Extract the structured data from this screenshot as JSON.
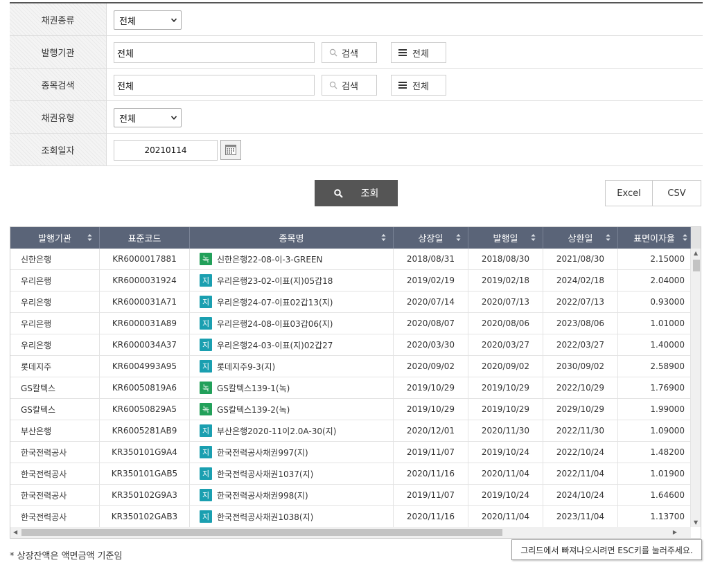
{
  "filters": {
    "bond_type": {
      "label": "채권종류",
      "value": "전체"
    },
    "issuer": {
      "label": "발행기관",
      "value": "전체",
      "search_label": "검색",
      "all_label": "전체"
    },
    "item_search": {
      "label": "종목검색",
      "value": "전체",
      "search_label": "검색",
      "all_label": "전체"
    },
    "bond_kind": {
      "label": "채권유형",
      "value": "전체"
    },
    "query_date": {
      "label": "조회일자",
      "value": "20210114"
    }
  },
  "actions": {
    "query_label": "조회",
    "excel_label": "Excel",
    "csv_label": "CSV"
  },
  "grid": {
    "columns": [
      "발행기관",
      "표준코드",
      "종목명",
      "상장일",
      "발행일",
      "상환일",
      "표면이자율"
    ],
    "rows": [
      {
        "issuer": "신한은행",
        "code": "KR6000017881",
        "badge": "녹",
        "name": "신한은행22-08-이-3-GREEN",
        "listed": "2018/08/31",
        "issued": "2018/08/30",
        "maturity": "2021/08/30",
        "rate": "2.15000"
      },
      {
        "issuer": "우리은행",
        "code": "KR6000031924",
        "badge": "지",
        "name": "우리은행23-02-이표(지)05갑18",
        "listed": "2019/02/19",
        "issued": "2019/02/18",
        "maturity": "2024/02/18",
        "rate": "2.04000"
      },
      {
        "issuer": "우리은행",
        "code": "KR6000031A71",
        "badge": "지",
        "name": "우리은행24-07-이표02갑13(지)",
        "listed": "2020/07/14",
        "issued": "2020/07/13",
        "maturity": "2022/07/13",
        "rate": "0.93000"
      },
      {
        "issuer": "우리은행",
        "code": "KR6000031A89",
        "badge": "지",
        "name": "우리은행24-08-이표03갑06(지)",
        "listed": "2020/08/07",
        "issued": "2020/08/06",
        "maturity": "2023/08/06",
        "rate": "1.01000"
      },
      {
        "issuer": "우리은행",
        "code": "KR6000034A37",
        "badge": "지",
        "name": "우리은행24-03-이표(지)02갑27",
        "listed": "2020/03/30",
        "issued": "2020/03/27",
        "maturity": "2022/03/27",
        "rate": "1.40000"
      },
      {
        "issuer": "롯데지주",
        "code": "KR6004993A95",
        "badge": "지",
        "name": "롯데지주9-3(지)",
        "listed": "2020/09/02",
        "issued": "2020/09/02",
        "maturity": "2030/09/02",
        "rate": "2.58900"
      },
      {
        "issuer": "GS칼텍스",
        "code": "KR60050819A6",
        "badge": "녹",
        "name": "GS칼텍스139-1(녹)",
        "listed": "2019/10/29",
        "issued": "2019/10/29",
        "maturity": "2022/10/29",
        "rate": "1.76900"
      },
      {
        "issuer": "GS칼텍스",
        "code": "KR60050829A5",
        "badge": "녹",
        "name": "GS칼텍스139-2(녹)",
        "listed": "2019/10/29",
        "issued": "2019/10/29",
        "maturity": "2029/10/29",
        "rate": "1.99000"
      },
      {
        "issuer": "부산은행",
        "code": "KR6005281AB9",
        "badge": "지",
        "name": "부산은행2020-11이2.0A-30(지)",
        "listed": "2020/12/01",
        "issued": "2020/11/30",
        "maturity": "2022/11/30",
        "rate": "1.09000"
      },
      {
        "issuer": "한국전력공사",
        "code": "KR350101G9A4",
        "badge": "지",
        "name": "한국전력공사채권997(지)",
        "listed": "2019/11/07",
        "issued": "2019/10/24",
        "maturity": "2022/10/24",
        "rate": "1.48200"
      },
      {
        "issuer": "한국전력공사",
        "code": "KR350101GAB5",
        "badge": "지",
        "name": "한국전력공사채권1037(지)",
        "listed": "2020/11/16",
        "issued": "2020/11/04",
        "maturity": "2022/11/04",
        "rate": "1.01900"
      },
      {
        "issuer": "한국전력공사",
        "code": "KR350102G9A3",
        "badge": "지",
        "name": "한국전력공사채권998(지)",
        "listed": "2019/11/07",
        "issued": "2019/10/24",
        "maturity": "2024/10/24",
        "rate": "1.64600"
      },
      {
        "issuer": "한국전력공사",
        "code": "KR350102GAB3",
        "badge": "지",
        "name": "한국전력공사채권1038(지)",
        "listed": "2020/11/16",
        "issued": "2020/11/04",
        "maturity": "2023/11/04",
        "rate": "1.13700"
      }
    ]
  },
  "colors": {
    "header_bg": "#5a6478",
    "badge_green": "#22a05a",
    "badge_teal": "#1a9fb0",
    "query_btn": "#555555"
  },
  "tooltip": "그리드에서 빠져나오시려면 ESC키를 눌러주세요.",
  "footnote": "* 상장잔액은 액면금액 기준임"
}
